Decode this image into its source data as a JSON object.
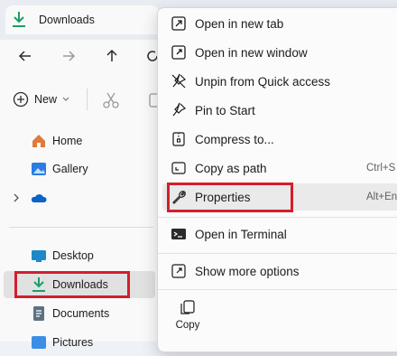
{
  "tab": {
    "title": "Downloads"
  },
  "commandbar": {
    "new_label": "New"
  },
  "sidebar": {
    "items": [
      {
        "label": "Home",
        "icon": "home-icon"
      },
      {
        "label": "Gallery",
        "icon": "gallery-icon"
      },
      {
        "label": "",
        "icon": "onedrive-icon"
      },
      {
        "label": "Desktop",
        "icon": "desktop-icon"
      },
      {
        "label": "Downloads",
        "icon": "download-icon"
      },
      {
        "label": "Documents",
        "icon": "documents-icon"
      },
      {
        "label": "Pictures",
        "icon": "pictures-icon"
      }
    ]
  },
  "context_menu": {
    "items": [
      {
        "label": "Open in new tab",
        "icon": "new-tab-icon"
      },
      {
        "label": "Open in new window",
        "icon": "new-window-icon"
      },
      {
        "label": "Unpin from Quick access",
        "icon": "unpin-icon"
      },
      {
        "label": "Pin to Start",
        "icon": "pin-icon"
      },
      {
        "label": "Compress to...",
        "icon": "compress-icon"
      },
      {
        "label": "Copy as path",
        "icon": "copy-path-icon",
        "shortcut": "Ctrl+S"
      },
      {
        "label": "Properties",
        "icon": "wrench-icon",
        "shortcut": "Alt+En"
      },
      {
        "label": "Open in Terminal",
        "icon": "terminal-icon"
      },
      {
        "label": "Show more options",
        "icon": "more-options-icon"
      }
    ],
    "copy_label": "Copy"
  },
  "colors": {
    "highlight": "#d21f2c",
    "accent": "#1a9e6a",
    "link_blue": "#0067c0"
  }
}
